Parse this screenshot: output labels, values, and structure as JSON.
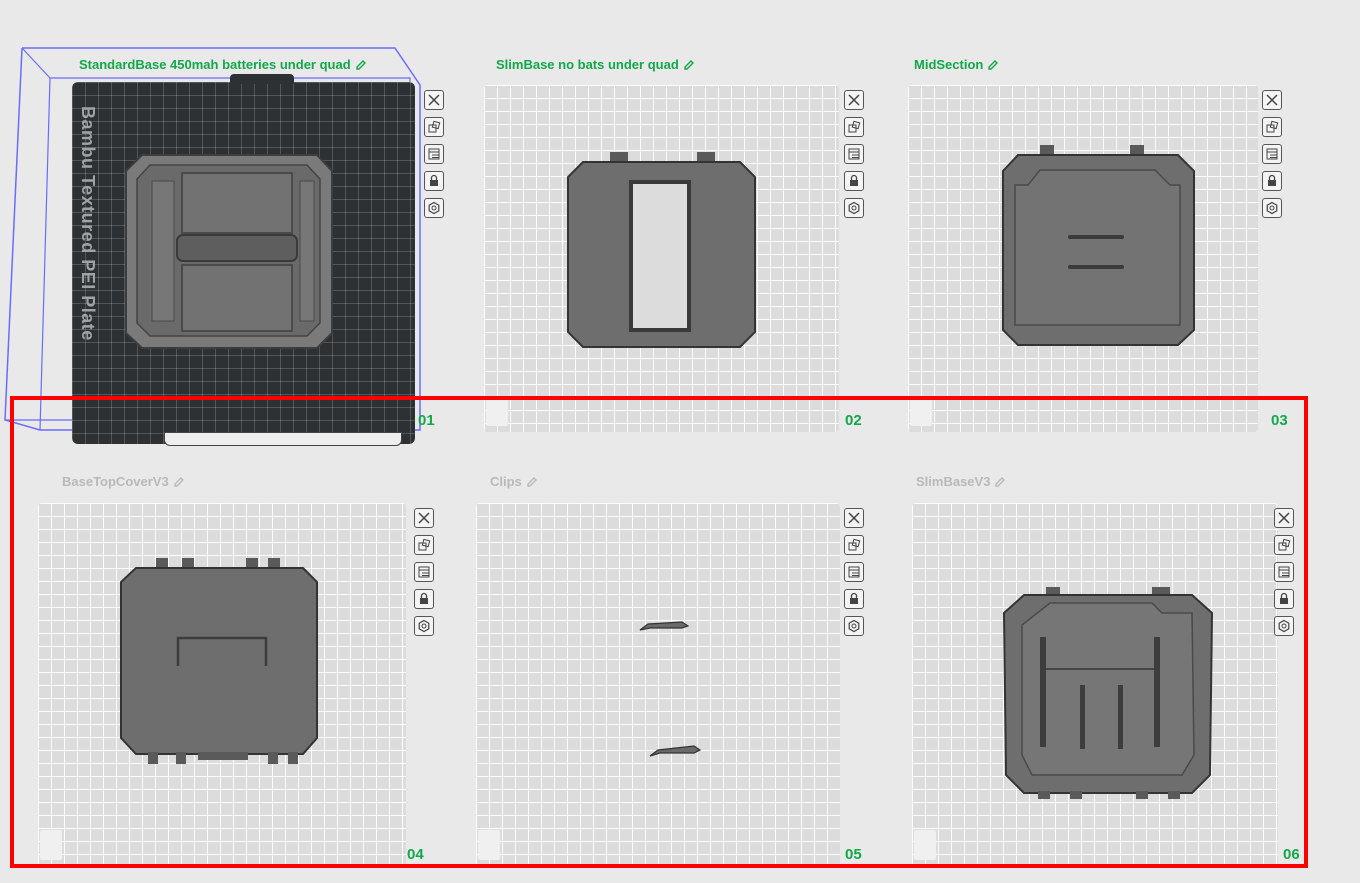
{
  "plates": [
    {
      "number": "01",
      "name": "StandardBase 450mah batteries under quad",
      "selected": true,
      "bed_label": "Bambu Textured PEI Plate"
    },
    {
      "number": "02",
      "name": "SlimBase no bats under quad",
      "selected": false
    },
    {
      "number": "03",
      "name": "MidSection",
      "selected": false
    },
    {
      "number": "04",
      "name": "BaseTopCoverV3",
      "selected": false
    },
    {
      "number": "05",
      "name": "Clips",
      "selected": false
    },
    {
      "number": "06",
      "name": "SlimBaseV3",
      "selected": false
    }
  ],
  "toolbar_icons": [
    "close-icon",
    "arrange-icon",
    "layout-icon",
    "lock-icon",
    "settings-icon"
  ],
  "colors": {
    "accent": "#12a84a",
    "selection": "#ff0000",
    "bounding_box": "#6b6bff",
    "model": "#6d6d6d"
  }
}
